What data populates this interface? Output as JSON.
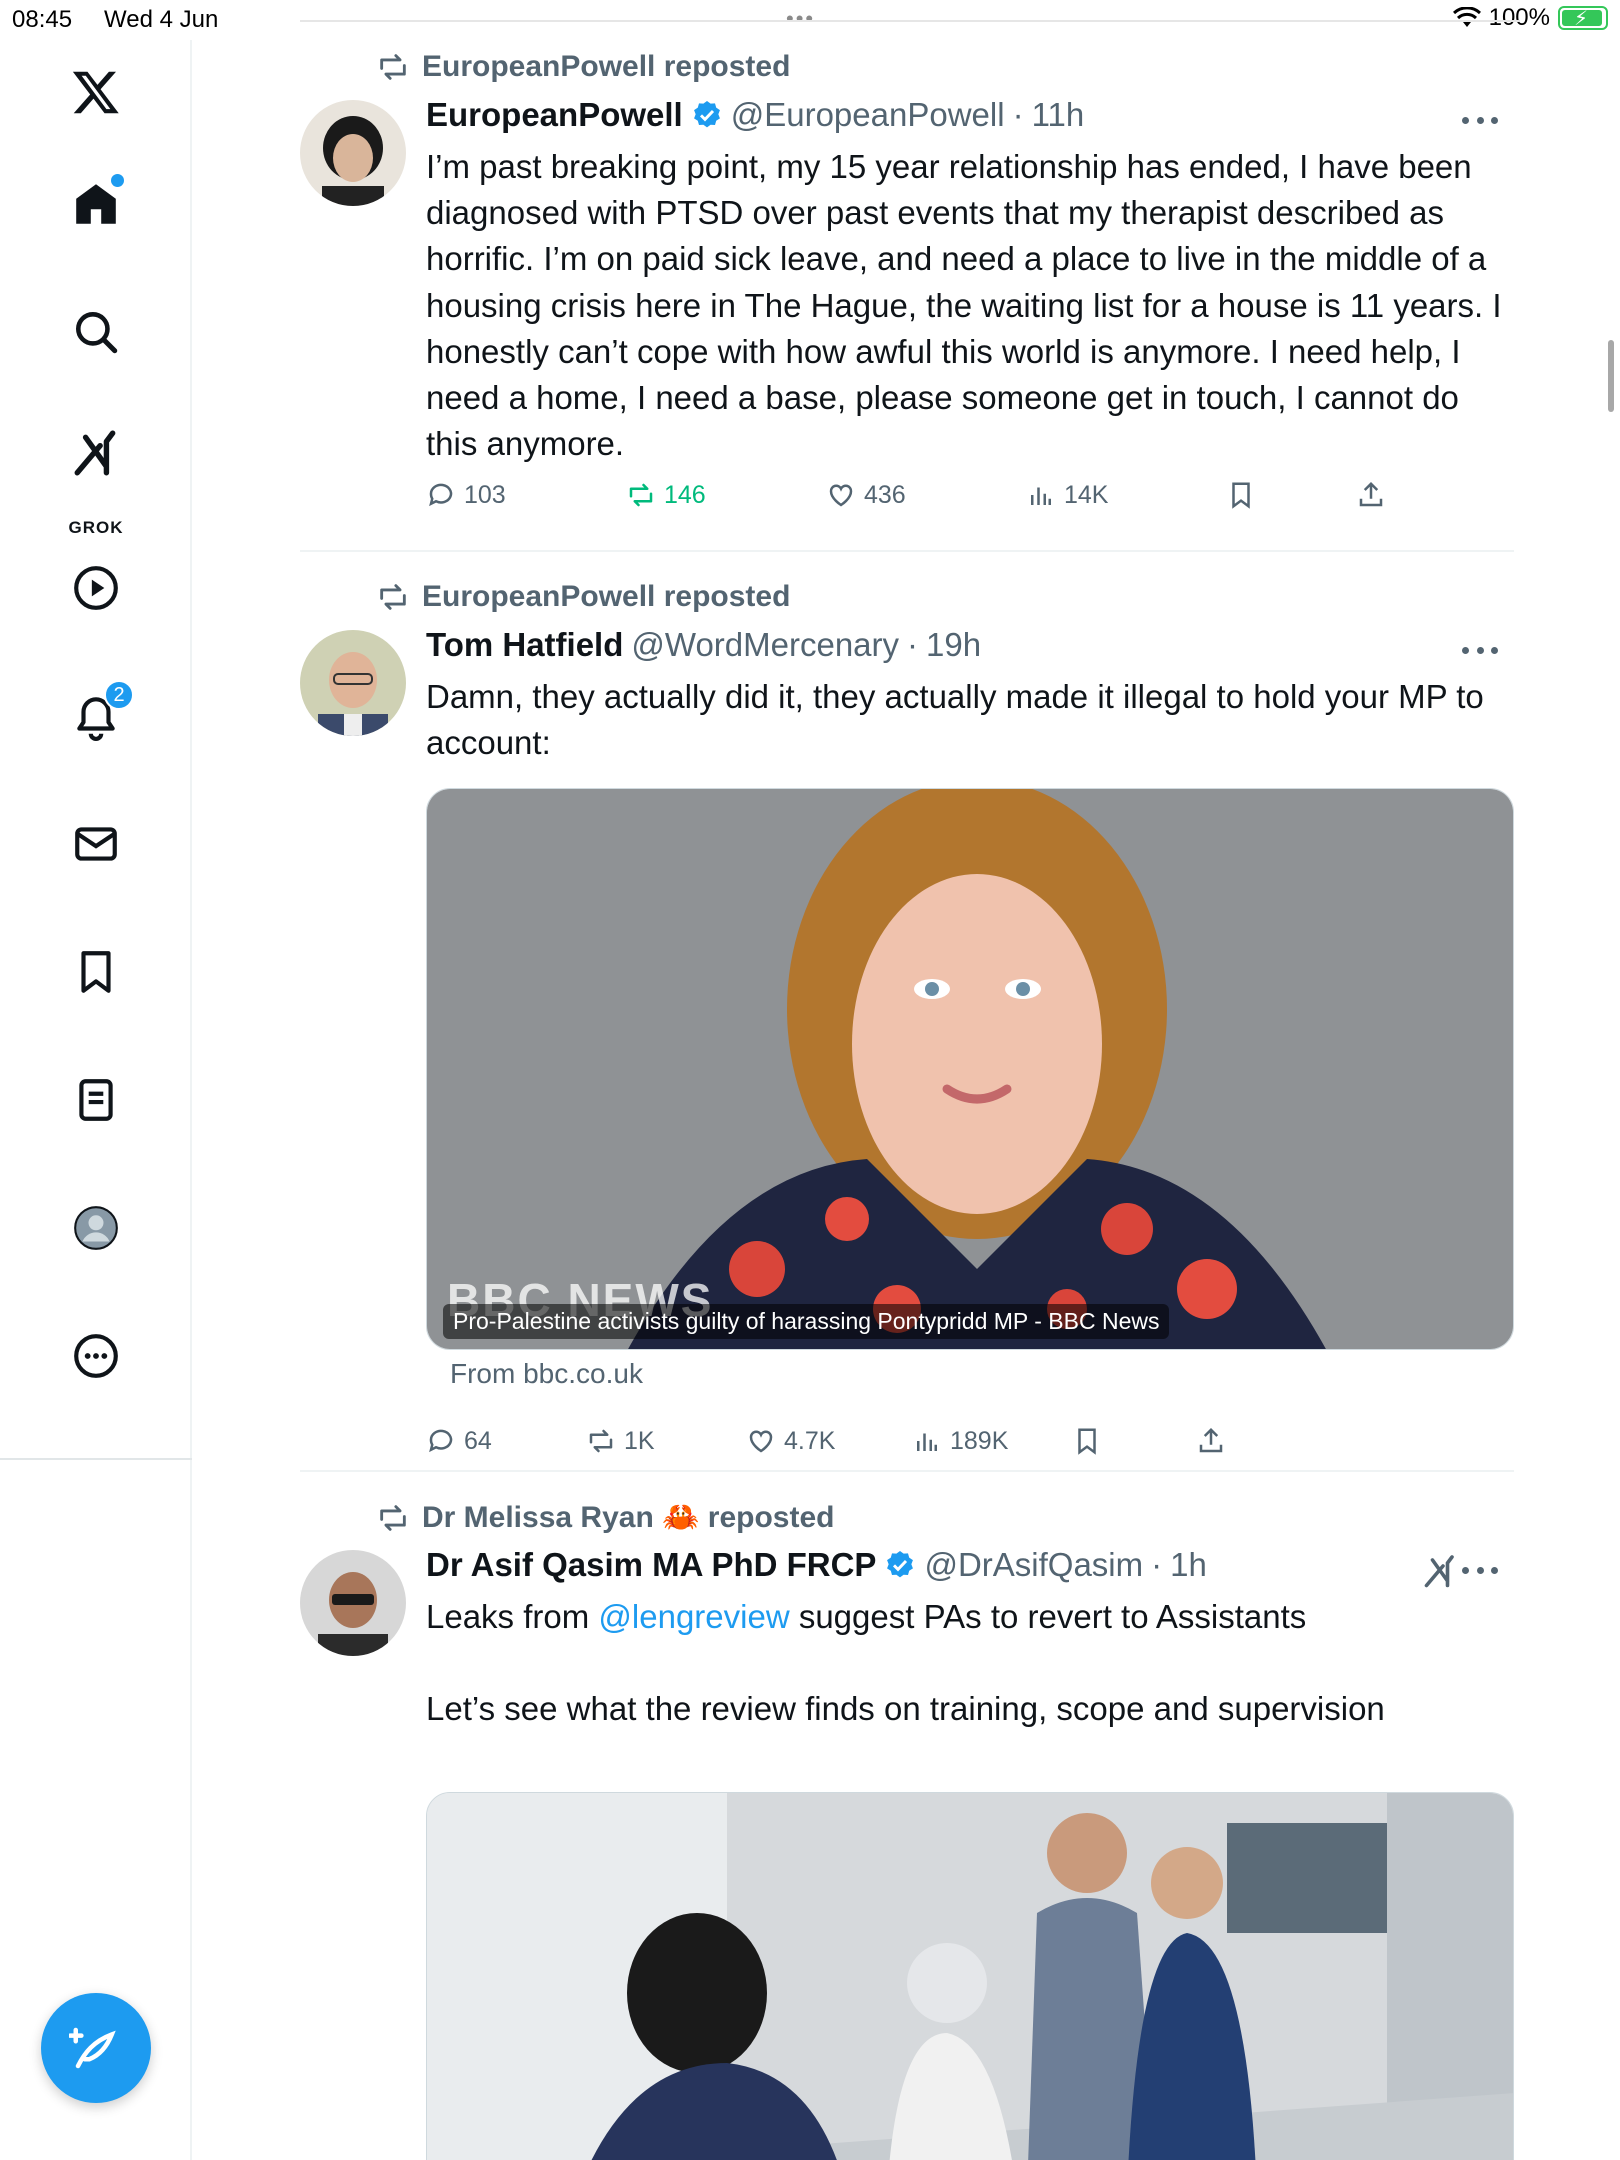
{
  "status_bar": {
    "time": "08:45",
    "date": "Wed 4 Jun",
    "battery": "100%"
  },
  "sidebar": {
    "grok_label": "GROK",
    "notifications_count": "2",
    "accent_color": "#1d9bf0"
  },
  "tweets": [
    {
      "repost_label": "EuropeanPowell reposted",
      "name": "EuropeanPowell",
      "verified": true,
      "handle": "@EuropeanPowell",
      "time": "11h",
      "text": "I’m past breaking point, my 15 year relationship has ended, I have been diagnosed with PTSD over past events that my therapist described as horrific. I’m on paid sick leave, and need a place to live in the middle of a housing crisis here in The Hague, the waiting list for a house is 11 years. I honestly can’t cope with how awful this world is anymore. I need help, I need a home, I need a base, please someone get in touch, I cannot do this anymore.",
      "replies": "103",
      "reposts": "146",
      "likes": "436",
      "views": "14K"
    },
    {
      "repost_label": "EuropeanPowell reposted",
      "name": "Tom Hatfield",
      "verified": false,
      "handle": "@WordMercenary",
      "time": "19h",
      "text": "Damn, they actually did it, they actually made it illegal to hold your MP to account:",
      "media_caption": "Pro-Palestine activists guilty of harassing Pontypridd MP - BBC News",
      "media_watermark": "BBC NEWS",
      "link_source": "From bbc.co.uk",
      "replies": "64",
      "reposts": "1K",
      "likes": "4.7K",
      "views": "189K"
    },
    {
      "repost_label": "Dr Melissa Ryan 🦀 reposted",
      "name": "Dr Asif Qasim MA PhD FRCP",
      "verified": true,
      "handle": "@DrAsifQasim",
      "time": "1h",
      "text_before": "Leaks from ",
      "mention": "@lengreview",
      "text_after": " suggest PAs to revert to Assistants\n\nLet’s see what the review finds on training, scope and supervision"
    }
  ]
}
